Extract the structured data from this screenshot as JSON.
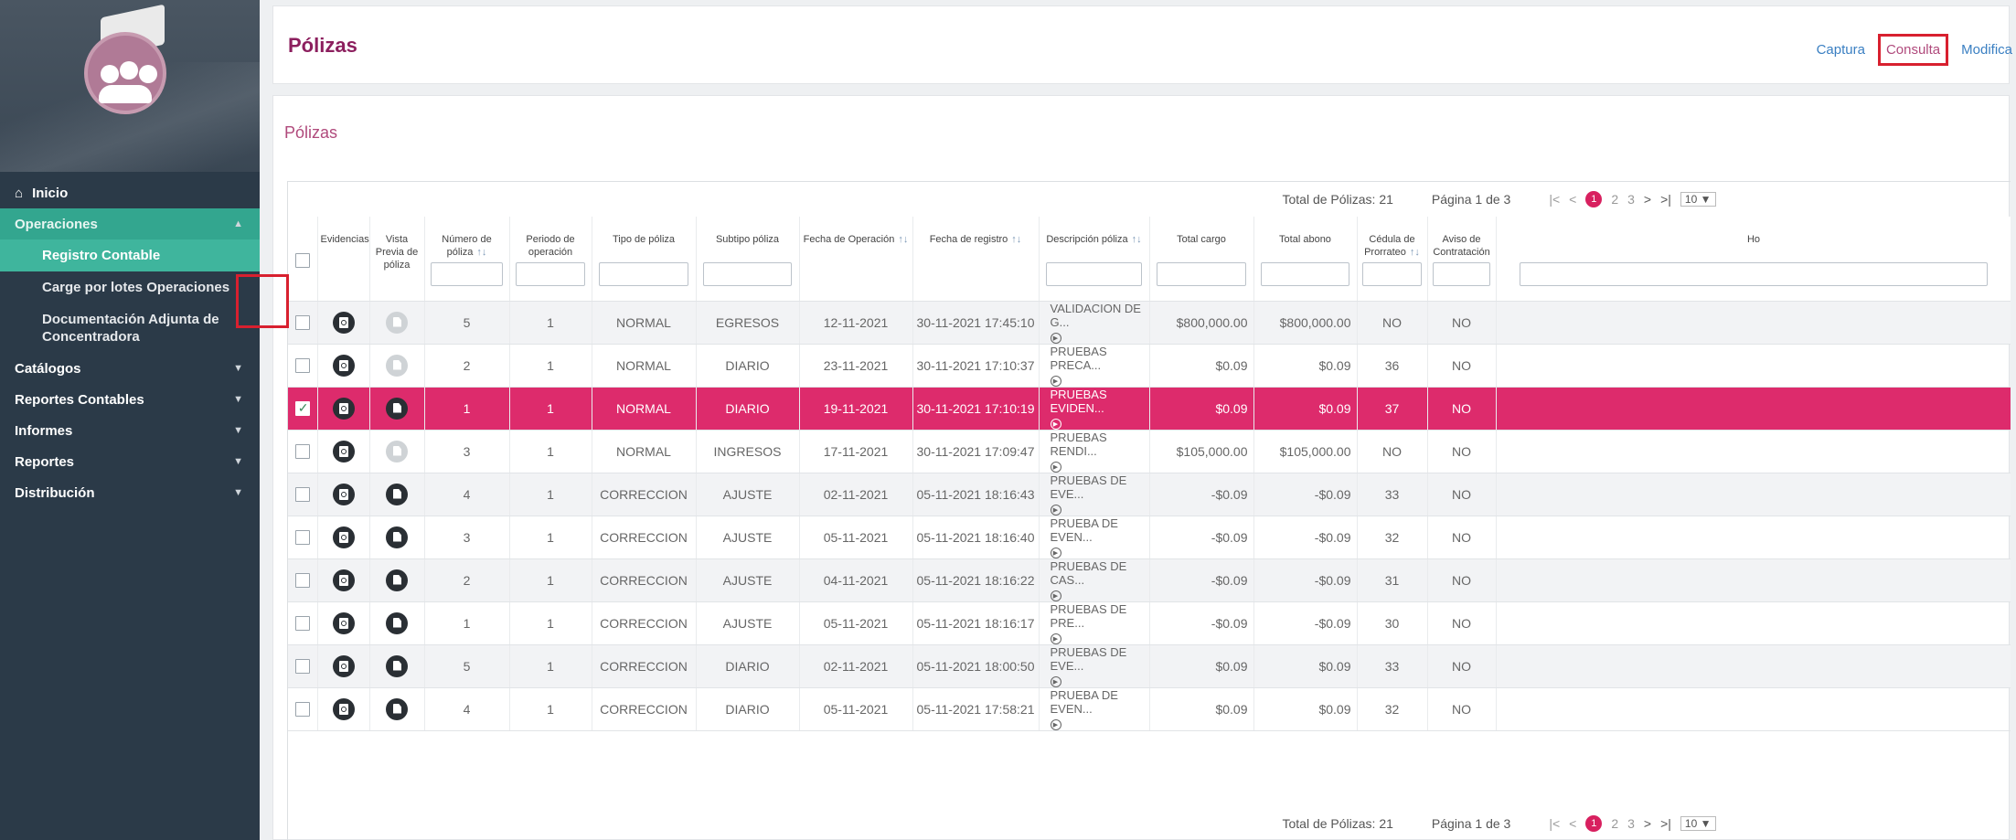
{
  "sidebar": {
    "nav": [
      {
        "label": "Inicio",
        "icon": "home-icon",
        "active": false
      },
      {
        "label": "Operaciones",
        "active": true,
        "children": [
          {
            "label": "Registro Contable",
            "active": true
          },
          {
            "label": "Carge por lotes Operaciones",
            "active": false
          },
          {
            "label": "Documentación Adjunta de Concentradora",
            "active": false
          }
        ]
      },
      {
        "label": "Catálogos",
        "active": false
      },
      {
        "label": "Reportes Contables",
        "active": false
      },
      {
        "label": "Informes",
        "active": false
      },
      {
        "label": "Reportes",
        "active": false
      },
      {
        "label": "Distribución",
        "active": false
      }
    ]
  },
  "header": {
    "title": "Pólizas",
    "links": [
      "Captura",
      "Consulta",
      "Modifica"
    ],
    "selected_link": "Consulta"
  },
  "content": {
    "section_title": "Pólizas",
    "pager": {
      "total_label": "Total de Pólizas: 21",
      "page_label": "Página 1 de 3",
      "first": "|<",
      "prev": "<",
      "current_page": "1",
      "page2": "2",
      "page3": "3",
      "next": ">",
      "last": ">|",
      "page_size": "10"
    },
    "columns": [
      {
        "label": "",
        "filter": false
      },
      {
        "label": "Evidencias",
        "filter": false
      },
      {
        "label": "Vista Previa de póliza",
        "filter": false
      },
      {
        "label": "Número de póliza",
        "sortable": true,
        "filter": true
      },
      {
        "label": "Periodo de operación",
        "filter": true
      },
      {
        "label": "Tipo de póliza",
        "filter": true
      },
      {
        "label": "Subtipo póliza",
        "filter": true
      },
      {
        "label": "Fecha de Operación",
        "sortable": true,
        "filter": false
      },
      {
        "label": "Fecha de registro",
        "sortable": true,
        "filter": false
      },
      {
        "label": "Descripción póliza",
        "sortable": true,
        "filter": true
      },
      {
        "label": "Total cargo",
        "filter": true
      },
      {
        "label": "Total abono",
        "filter": true
      },
      {
        "label": "Cédula de Prorrateo",
        "sortable": true,
        "filter": true
      },
      {
        "label": "Aviso de Contratación",
        "filter": true
      },
      {
        "label": "Ho",
        "filter": true
      }
    ],
    "rows": [
      {
        "checked": false,
        "preview_enabled": false,
        "numero": "5",
        "periodo": "1",
        "tipo": "NORMAL",
        "subtipo": "EGRESOS",
        "fecha_op": "12-11-2021",
        "fecha_reg": "30-11-2021 17:45:10",
        "desc": "VALIDACION DE G...",
        "cargo": "$800,000.00",
        "abono": "$800,000.00",
        "cedula": "NO",
        "aviso": "NO"
      },
      {
        "checked": false,
        "preview_enabled": false,
        "numero": "2",
        "periodo": "1",
        "tipo": "NORMAL",
        "subtipo": "DIARIO",
        "fecha_op": "23-11-2021",
        "fecha_reg": "30-11-2021 17:10:37",
        "desc": "PRUEBAS PRECA...",
        "cargo": "$0.09",
        "abono": "$0.09",
        "cedula": "36",
        "aviso": "NO"
      },
      {
        "checked": true,
        "preview_enabled": true,
        "numero": "1",
        "periodo": "1",
        "tipo": "NORMAL",
        "subtipo": "DIARIO",
        "fecha_op": "19-11-2021",
        "fecha_reg": "30-11-2021 17:10:19",
        "desc": "PRUEBAS EVIDEN...",
        "cargo": "$0.09",
        "abono": "$0.09",
        "cedula": "37",
        "aviso": "NO"
      },
      {
        "checked": false,
        "preview_enabled": false,
        "numero": "3",
        "periodo": "1",
        "tipo": "NORMAL",
        "subtipo": "INGRESOS",
        "fecha_op": "17-11-2021",
        "fecha_reg": "30-11-2021 17:09:47",
        "desc": "PRUEBAS RENDI...",
        "cargo": "$105,000.00",
        "abono": "$105,000.00",
        "cedula": "NO",
        "aviso": "NO"
      },
      {
        "checked": false,
        "preview_enabled": true,
        "numero": "4",
        "periodo": "1",
        "tipo": "CORRECCION",
        "subtipo": "AJUSTE",
        "fecha_op": "02-11-2021",
        "fecha_reg": "05-11-2021 18:16:43",
        "desc": "PRUEBAS DE EVE...",
        "cargo": "-$0.09",
        "abono": "-$0.09",
        "cedula": "33",
        "aviso": "NO"
      },
      {
        "checked": false,
        "preview_enabled": true,
        "numero": "3",
        "periodo": "1",
        "tipo": "CORRECCION",
        "subtipo": "AJUSTE",
        "fecha_op": "05-11-2021",
        "fecha_reg": "05-11-2021 18:16:40",
        "desc": "PRUEBA DE EVEN...",
        "cargo": "-$0.09",
        "abono": "-$0.09",
        "cedula": "32",
        "aviso": "NO"
      },
      {
        "checked": false,
        "preview_enabled": true,
        "numero": "2",
        "periodo": "1",
        "tipo": "CORRECCION",
        "subtipo": "AJUSTE",
        "fecha_op": "04-11-2021",
        "fecha_reg": "05-11-2021 18:16:22",
        "desc": "PRUEBAS DE CAS...",
        "cargo": "-$0.09",
        "abono": "-$0.09",
        "cedula": "31",
        "aviso": "NO"
      },
      {
        "checked": false,
        "preview_enabled": true,
        "numero": "1",
        "periodo": "1",
        "tipo": "CORRECCION",
        "subtipo": "AJUSTE",
        "fecha_op": "05-11-2021",
        "fecha_reg": "05-11-2021 18:16:17",
        "desc": "PRUEBAS DE PRE...",
        "cargo": "-$0.09",
        "abono": "-$0.09",
        "cedula": "30",
        "aviso": "NO"
      },
      {
        "checked": false,
        "preview_enabled": true,
        "numero": "5",
        "periodo": "1",
        "tipo": "CORRECCION",
        "subtipo": "DIARIO",
        "fecha_op": "02-11-2021",
        "fecha_reg": "05-11-2021 18:00:50",
        "desc": "PRUEBAS DE EVE...",
        "cargo": "$0.09",
        "abono": "$0.09",
        "cedula": "33",
        "aviso": "NO"
      },
      {
        "checked": false,
        "preview_enabled": true,
        "numero": "4",
        "periodo": "1",
        "tipo": "CORRECCION",
        "subtipo": "DIARIO",
        "fecha_op": "05-11-2021",
        "fecha_reg": "05-11-2021 17:58:21",
        "desc": "PRUEBA DE EVEN...",
        "cargo": "$0.09",
        "abono": "$0.09",
        "cedula": "32",
        "aviso": "NO"
      }
    ]
  },
  "colors": {
    "brand": "#8c1f5e",
    "accent": "#dd2b6c",
    "sidebar": "#2b3a48",
    "active_nav": "#33a68f",
    "annotation": "#d8202f"
  }
}
